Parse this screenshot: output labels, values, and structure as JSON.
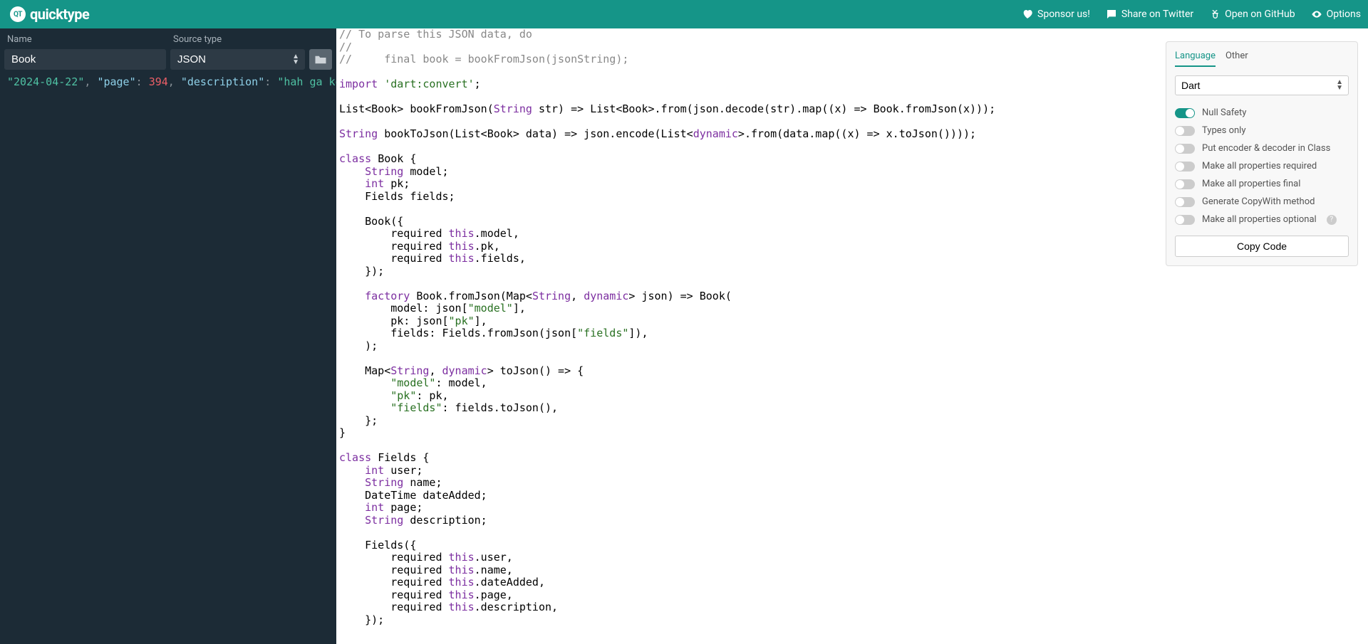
{
  "header": {
    "logo_text": "quicktype",
    "logo_badge": "QT",
    "links": {
      "sponsor": "Sponsor us!",
      "twitter": "Share on Twitter",
      "github": "Open on GitHub",
      "options": "Options"
    }
  },
  "sidebar": {
    "name_label": "Name",
    "name_value": "Book",
    "source_label": "Source type",
    "source_value": "JSON",
    "json_line": {
      "date": "\"2024-04-22\"",
      "page_key": "\"page\"",
      "page_val": "394",
      "desc_key": "\"description\"",
      "desc_val": "\"hah ga konek\""
    }
  },
  "options": {
    "tab_language": "Language",
    "tab_other": "Other",
    "language_value": "Dart",
    "opts": {
      "null_safety": "Null Safety",
      "types_only": "Types only",
      "encoder": "Put encoder & decoder in Class",
      "required": "Make all properties required",
      "final": "Make all properties final",
      "copywith": "Generate CopyWith method",
      "optional": "Make all properties optional"
    },
    "copy_btn": "Copy Code"
  },
  "code": {
    "c1": "// To parse this JSON data, do",
    "c2": "//",
    "c3": "//     final book = bookFromJson(jsonString);",
    "imp": "import",
    "imp_s": "'dart:convert'",
    "l4a": "List<Book> bookFromJson(",
    "l4b": " str) => List<Book>.from(json.decode(str).map((x) => Book.fromJson(x)));",
    "l5a": " bookToJson(List<Book> data) => json.encode(List<",
    "l5b": ">.from(data.map((x) => x.toJson())));",
    "cls": "class",
    "book": "Book {",
    "str": "String",
    "int": "int",
    "model": " model;",
    "pk": " pk;",
    "fields_decl": "    Fields fields;",
    "book_ctor": "    Book({",
    "req": "        required ",
    "this": "this",
    "dot_model": ".model,",
    "dot_pk": ".pk,",
    "dot_fields": ".fields,",
    "ctor_end": "    });",
    "factory": "factory",
    "factory_sig": " Book.fromJson(Map<",
    "dyn": "dynamic",
    "factory_end": "> json) => Book(",
    "from_model": "        model: json[",
    "s_model": "\"model\"",
    "from_pk": "        pk: json[",
    "s_pk": "\"pk\"",
    "from_fields": "        fields: Fields.fromJson(json[",
    "s_fields": "\"fields\"",
    "closep": "    );",
    "tojson_sig_a": "    Map<",
    "tojson_sig_b": "> toJson() => {",
    "tj_model": ": model,",
    "tj_pk": ": pk,",
    "tj_fields": ": fields.toJson(),",
    "brace_end": "    };",
    "fields_cls": "Fields {",
    "user": " user;",
    "name": " name;",
    "dt": "    DateTime dateAdded;",
    "page": " page;",
    "desc": " description;",
    "fields_ctor": "    Fields({",
    "dot_user": ".user,",
    "dot_name": ".name,",
    "dot_dateadded": ".dateAdded,",
    "dot_page": ".page,",
    "dot_desc": ".description,"
  }
}
